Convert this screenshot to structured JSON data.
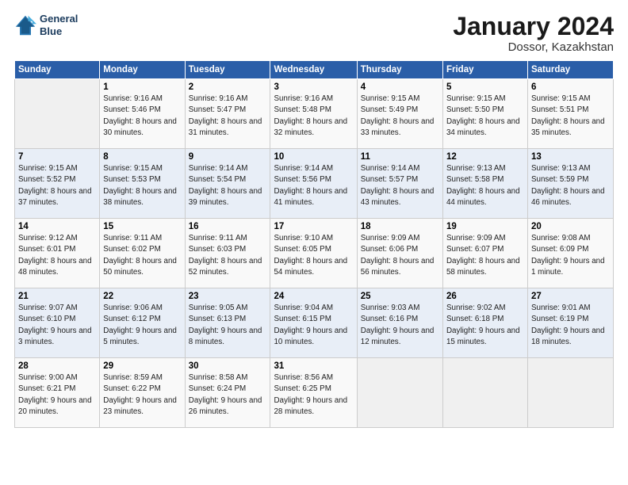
{
  "header": {
    "logo_line1": "General",
    "logo_line2": "Blue",
    "title": "January 2024",
    "location": "Dossor, Kazakhstan"
  },
  "weekdays": [
    "Sunday",
    "Monday",
    "Tuesday",
    "Wednesday",
    "Thursday",
    "Friday",
    "Saturday"
  ],
  "weeks": [
    [
      {
        "day": "",
        "sunrise": "",
        "sunset": "",
        "daylight": ""
      },
      {
        "day": "1",
        "sunrise": "Sunrise: 9:16 AM",
        "sunset": "Sunset: 5:46 PM",
        "daylight": "Daylight: 8 hours and 30 minutes."
      },
      {
        "day": "2",
        "sunrise": "Sunrise: 9:16 AM",
        "sunset": "Sunset: 5:47 PM",
        "daylight": "Daylight: 8 hours and 31 minutes."
      },
      {
        "day": "3",
        "sunrise": "Sunrise: 9:16 AM",
        "sunset": "Sunset: 5:48 PM",
        "daylight": "Daylight: 8 hours and 32 minutes."
      },
      {
        "day": "4",
        "sunrise": "Sunrise: 9:15 AM",
        "sunset": "Sunset: 5:49 PM",
        "daylight": "Daylight: 8 hours and 33 minutes."
      },
      {
        "day": "5",
        "sunrise": "Sunrise: 9:15 AM",
        "sunset": "Sunset: 5:50 PM",
        "daylight": "Daylight: 8 hours and 34 minutes."
      },
      {
        "day": "6",
        "sunrise": "Sunrise: 9:15 AM",
        "sunset": "Sunset: 5:51 PM",
        "daylight": "Daylight: 8 hours and 35 minutes."
      }
    ],
    [
      {
        "day": "7",
        "sunrise": "Sunrise: 9:15 AM",
        "sunset": "Sunset: 5:52 PM",
        "daylight": "Daylight: 8 hours and 37 minutes."
      },
      {
        "day": "8",
        "sunrise": "Sunrise: 9:15 AM",
        "sunset": "Sunset: 5:53 PM",
        "daylight": "Daylight: 8 hours and 38 minutes."
      },
      {
        "day": "9",
        "sunrise": "Sunrise: 9:14 AM",
        "sunset": "Sunset: 5:54 PM",
        "daylight": "Daylight: 8 hours and 39 minutes."
      },
      {
        "day": "10",
        "sunrise": "Sunrise: 9:14 AM",
        "sunset": "Sunset: 5:56 PM",
        "daylight": "Daylight: 8 hours and 41 minutes."
      },
      {
        "day": "11",
        "sunrise": "Sunrise: 9:14 AM",
        "sunset": "Sunset: 5:57 PM",
        "daylight": "Daylight: 8 hours and 43 minutes."
      },
      {
        "day": "12",
        "sunrise": "Sunrise: 9:13 AM",
        "sunset": "Sunset: 5:58 PM",
        "daylight": "Daylight: 8 hours and 44 minutes."
      },
      {
        "day": "13",
        "sunrise": "Sunrise: 9:13 AM",
        "sunset": "Sunset: 5:59 PM",
        "daylight": "Daylight: 8 hours and 46 minutes."
      }
    ],
    [
      {
        "day": "14",
        "sunrise": "Sunrise: 9:12 AM",
        "sunset": "Sunset: 6:01 PM",
        "daylight": "Daylight: 8 hours and 48 minutes."
      },
      {
        "day": "15",
        "sunrise": "Sunrise: 9:11 AM",
        "sunset": "Sunset: 6:02 PM",
        "daylight": "Daylight: 8 hours and 50 minutes."
      },
      {
        "day": "16",
        "sunrise": "Sunrise: 9:11 AM",
        "sunset": "Sunset: 6:03 PM",
        "daylight": "Daylight: 8 hours and 52 minutes."
      },
      {
        "day": "17",
        "sunrise": "Sunrise: 9:10 AM",
        "sunset": "Sunset: 6:05 PM",
        "daylight": "Daylight: 8 hours and 54 minutes."
      },
      {
        "day": "18",
        "sunrise": "Sunrise: 9:09 AM",
        "sunset": "Sunset: 6:06 PM",
        "daylight": "Daylight: 8 hours and 56 minutes."
      },
      {
        "day": "19",
        "sunrise": "Sunrise: 9:09 AM",
        "sunset": "Sunset: 6:07 PM",
        "daylight": "Daylight: 8 hours and 58 minutes."
      },
      {
        "day": "20",
        "sunrise": "Sunrise: 9:08 AM",
        "sunset": "Sunset: 6:09 PM",
        "daylight": "Daylight: 9 hours and 1 minute."
      }
    ],
    [
      {
        "day": "21",
        "sunrise": "Sunrise: 9:07 AM",
        "sunset": "Sunset: 6:10 PM",
        "daylight": "Daylight: 9 hours and 3 minutes."
      },
      {
        "day": "22",
        "sunrise": "Sunrise: 9:06 AM",
        "sunset": "Sunset: 6:12 PM",
        "daylight": "Daylight: 9 hours and 5 minutes."
      },
      {
        "day": "23",
        "sunrise": "Sunrise: 9:05 AM",
        "sunset": "Sunset: 6:13 PM",
        "daylight": "Daylight: 9 hours and 8 minutes."
      },
      {
        "day": "24",
        "sunrise": "Sunrise: 9:04 AM",
        "sunset": "Sunset: 6:15 PM",
        "daylight": "Daylight: 9 hours and 10 minutes."
      },
      {
        "day": "25",
        "sunrise": "Sunrise: 9:03 AM",
        "sunset": "Sunset: 6:16 PM",
        "daylight": "Daylight: 9 hours and 12 minutes."
      },
      {
        "day": "26",
        "sunrise": "Sunrise: 9:02 AM",
        "sunset": "Sunset: 6:18 PM",
        "daylight": "Daylight: 9 hours and 15 minutes."
      },
      {
        "day": "27",
        "sunrise": "Sunrise: 9:01 AM",
        "sunset": "Sunset: 6:19 PM",
        "daylight": "Daylight: 9 hours and 18 minutes."
      }
    ],
    [
      {
        "day": "28",
        "sunrise": "Sunrise: 9:00 AM",
        "sunset": "Sunset: 6:21 PM",
        "daylight": "Daylight: 9 hours and 20 minutes."
      },
      {
        "day": "29",
        "sunrise": "Sunrise: 8:59 AM",
        "sunset": "Sunset: 6:22 PM",
        "daylight": "Daylight: 9 hours and 23 minutes."
      },
      {
        "day": "30",
        "sunrise": "Sunrise: 8:58 AM",
        "sunset": "Sunset: 6:24 PM",
        "daylight": "Daylight: 9 hours and 26 minutes."
      },
      {
        "day": "31",
        "sunrise": "Sunrise: 8:56 AM",
        "sunset": "Sunset: 6:25 PM",
        "daylight": "Daylight: 9 hours and 28 minutes."
      },
      {
        "day": "",
        "sunrise": "",
        "sunset": "",
        "daylight": ""
      },
      {
        "day": "",
        "sunrise": "",
        "sunset": "",
        "daylight": ""
      },
      {
        "day": "",
        "sunrise": "",
        "sunset": "",
        "daylight": ""
      }
    ]
  ]
}
